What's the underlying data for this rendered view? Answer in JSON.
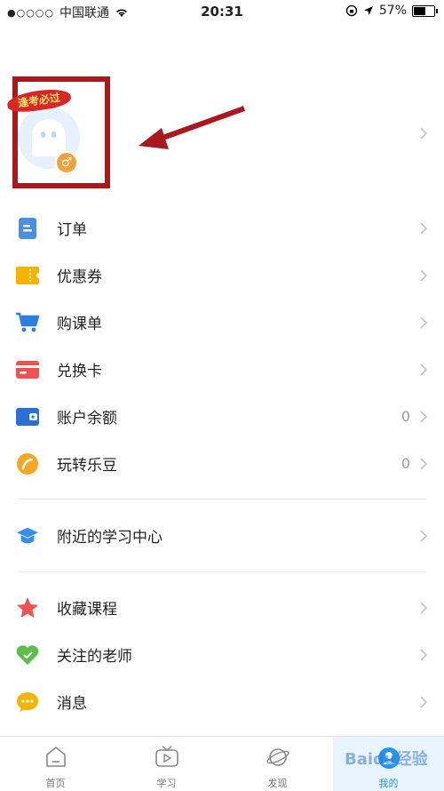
{
  "status_bar": {
    "signal": "●○○○○",
    "carrier": "中国联通",
    "time": "20:31",
    "battery_text": "57%",
    "battery_level": 0.57
  },
  "profile": {
    "badge_text": "逢考必过",
    "gender_symbol": "♂",
    "highlight_color": "#a8191e"
  },
  "menu": {
    "group1": [
      {
        "label": "订单",
        "icon": "order-icon",
        "value": ""
      },
      {
        "label": "优惠券",
        "icon": "coupon-icon",
        "value": ""
      },
      {
        "label": "购课单",
        "icon": "cart-icon",
        "value": ""
      },
      {
        "label": "兑换卡",
        "icon": "card-icon",
        "value": ""
      },
      {
        "label": "账户余额",
        "icon": "wallet-icon",
        "value": "0"
      },
      {
        "label": "玩转乐豆",
        "icon": "bean-icon",
        "value": "0"
      }
    ],
    "group2": [
      {
        "label": "附近的学习中心",
        "icon": "graduation-cap-icon",
        "value": ""
      }
    ],
    "group3": [
      {
        "label": "收藏课程",
        "icon": "star-icon",
        "value": ""
      },
      {
        "label": "关注的老师",
        "icon": "heart-icon",
        "value": ""
      },
      {
        "label": "消息",
        "icon": "message-icon",
        "value": ""
      }
    ]
  },
  "tabs": [
    {
      "label": "首页",
      "icon": "home-icon"
    },
    {
      "label": "学习",
      "icon": "tv-icon"
    },
    {
      "label": "发现",
      "icon": "planet-icon"
    },
    {
      "label": "我的",
      "icon": "profile-icon",
      "active": true
    }
  ],
  "watermark": "Baidu经验",
  "colors": {
    "accent": "#2196f3",
    "order": "#4a90e2",
    "coupon": "#f5b400",
    "cart": "#2d7fe0",
    "card": "#ef5350",
    "wallet": "#2b6fd6",
    "bean": "#f5a623",
    "cap": "#3a8ee6",
    "star": "#ef5350",
    "heart": "#5fbd4a",
    "message": "#f5b400"
  }
}
